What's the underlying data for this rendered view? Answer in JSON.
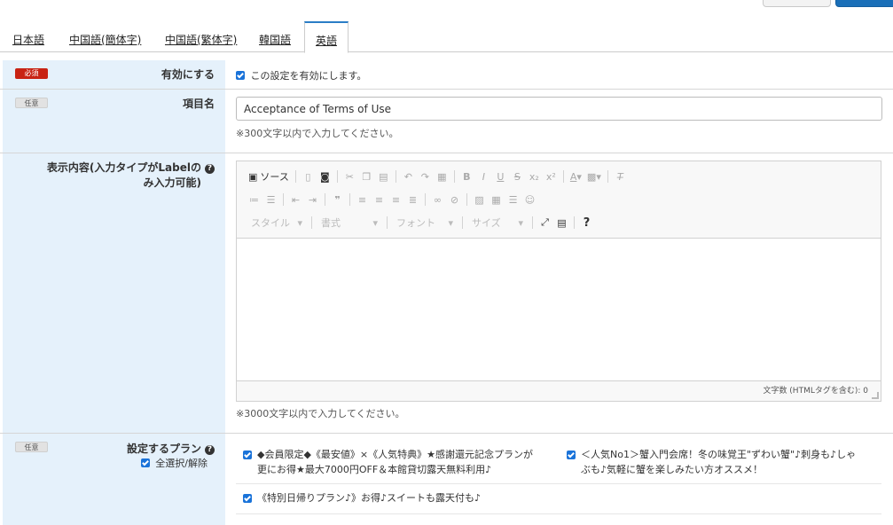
{
  "tabs": [
    "日本語",
    "中国語(簡体字)",
    "中国語(繁体字)",
    "韓国語",
    "英語"
  ],
  "active_tab_index": 4,
  "badges": {
    "required": "必須",
    "optional": "任意"
  },
  "enable_row": {
    "label": "有効にする",
    "checkbox_label": "この設定を有効にします。",
    "checked": true
  },
  "item_name_row": {
    "label": "項目名",
    "value": "Acceptance of Terms of Use",
    "hint": "※300文字以内で入力してください。"
  },
  "display_row": {
    "label_line1": "表示内容(入力タイプがLabelの",
    "label_line2": "み入力可能)",
    "source_button": "ソース",
    "combos": {
      "style": "スタイル",
      "format": "書式",
      "font": "フォント",
      "size": "サイズ"
    },
    "word_count": "文字数 (HTMLタグを含む): 0",
    "hint": "※3000文字以内で入力してください。"
  },
  "plan_row": {
    "label": "設定するプラン",
    "select_all": "全選択/解除",
    "plans": [
      {
        "line1": "◆会員限定◆《最安値》×《人気特典》★感謝還元記念プランが",
        "line2": "更にお得★最大7000円OFF＆本館貸切露天無料利用♪",
        "checked": true
      },
      {
        "line1": "＜人気No1＞蟹入門会席！冬の味覚王\"ずわい蟹\"♪刺身も♪しゃ",
        "line2": "ぶも♪気軽に蟹を楽しみたい方オススメ！",
        "checked": true
      },
      {
        "line1": "《特別日帰りプラン♪》お得♪スイートも露天付も♪",
        "line2": "",
        "checked": true
      }
    ]
  },
  "colors": {
    "label_bg": "#e5f1fb",
    "accent": "#2a7dc6",
    "required_badge": "#c82314",
    "checkbox": "#1a73d9"
  }
}
